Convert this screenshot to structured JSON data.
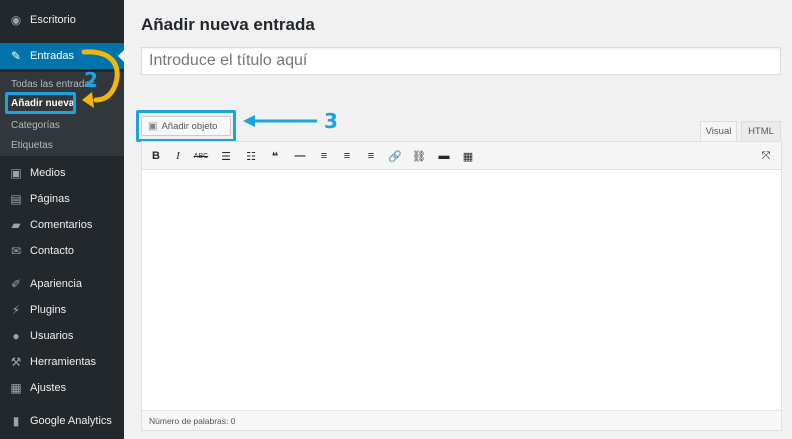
{
  "sidebar": {
    "items": [
      {
        "label": "Escritorio",
        "icon": "dashboard-icon"
      },
      {
        "label": "Entradas",
        "icon": "pushpin-icon"
      },
      {
        "label": "Medios",
        "icon": "media-icon"
      },
      {
        "label": "Páginas",
        "icon": "pages-icon"
      },
      {
        "label": "Comentarios",
        "icon": "comments-icon"
      },
      {
        "label": "Contacto",
        "icon": "mail-icon"
      },
      {
        "label": "Apariencia",
        "icon": "brush-icon"
      },
      {
        "label": "Plugins",
        "icon": "plug-icon"
      },
      {
        "label": "Usuarios",
        "icon": "users-icon"
      },
      {
        "label": "Herramientas",
        "icon": "wrench-icon"
      },
      {
        "label": "Ajustes",
        "icon": "settings-icon"
      },
      {
        "label": "Google Analytics",
        "icon": "chart-icon"
      }
    ],
    "submenu": [
      "Todas las entradas",
      "Añadir nueva",
      "Categorías",
      "Etiquetas"
    ]
  },
  "main": {
    "page_title": "Añadir nueva entrada",
    "title_placeholder": "Introduce el título aquí",
    "add_media_label": "Añadir objeto",
    "tabs": {
      "visual": "Visual",
      "html": "HTML"
    },
    "word_count": "Número de palabras: 0"
  },
  "annotations": {
    "step2": "2",
    "step3": "3"
  },
  "colors": {
    "sidebar_bg": "#23282d",
    "active_bg": "#0073aa",
    "highlight": "#1aa4e0",
    "arrow_yellow": "#f5b50a"
  }
}
